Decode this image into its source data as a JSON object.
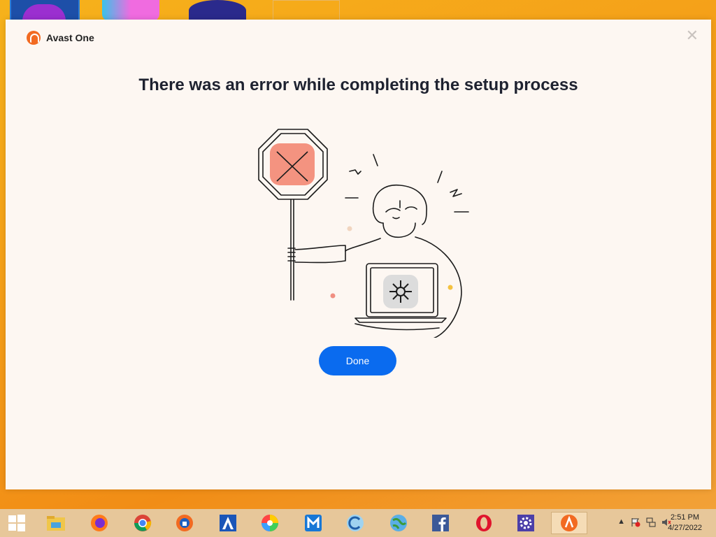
{
  "dialog": {
    "app_name": "Avast One",
    "close_glyph": "✕",
    "title": "There was an error while completing the setup process",
    "done_label": "Done",
    "accent_color": "#0a6bef",
    "brand_color": "#f26a21"
  },
  "taskbar": {
    "items": [
      {
        "name": "windows-start-icon"
      },
      {
        "name": "file-explorer-icon"
      },
      {
        "name": "firefox-icon"
      },
      {
        "name": "chrome-icon"
      },
      {
        "name": "avast-secure-browser-icon"
      },
      {
        "name": "avast-antivirus-icon"
      },
      {
        "name": "colorful-wheel-icon"
      },
      {
        "name": "maxthon-icon"
      },
      {
        "name": "ccleaner-icon"
      },
      {
        "name": "globe-icon"
      },
      {
        "name": "facebook-icon"
      },
      {
        "name": "opera-icon"
      },
      {
        "name": "settings-icon"
      },
      {
        "name": "avast-one-icon"
      }
    ],
    "tray_expand": "▲",
    "clock_time": "2:51 PM",
    "clock_date": "4/27/2022"
  }
}
